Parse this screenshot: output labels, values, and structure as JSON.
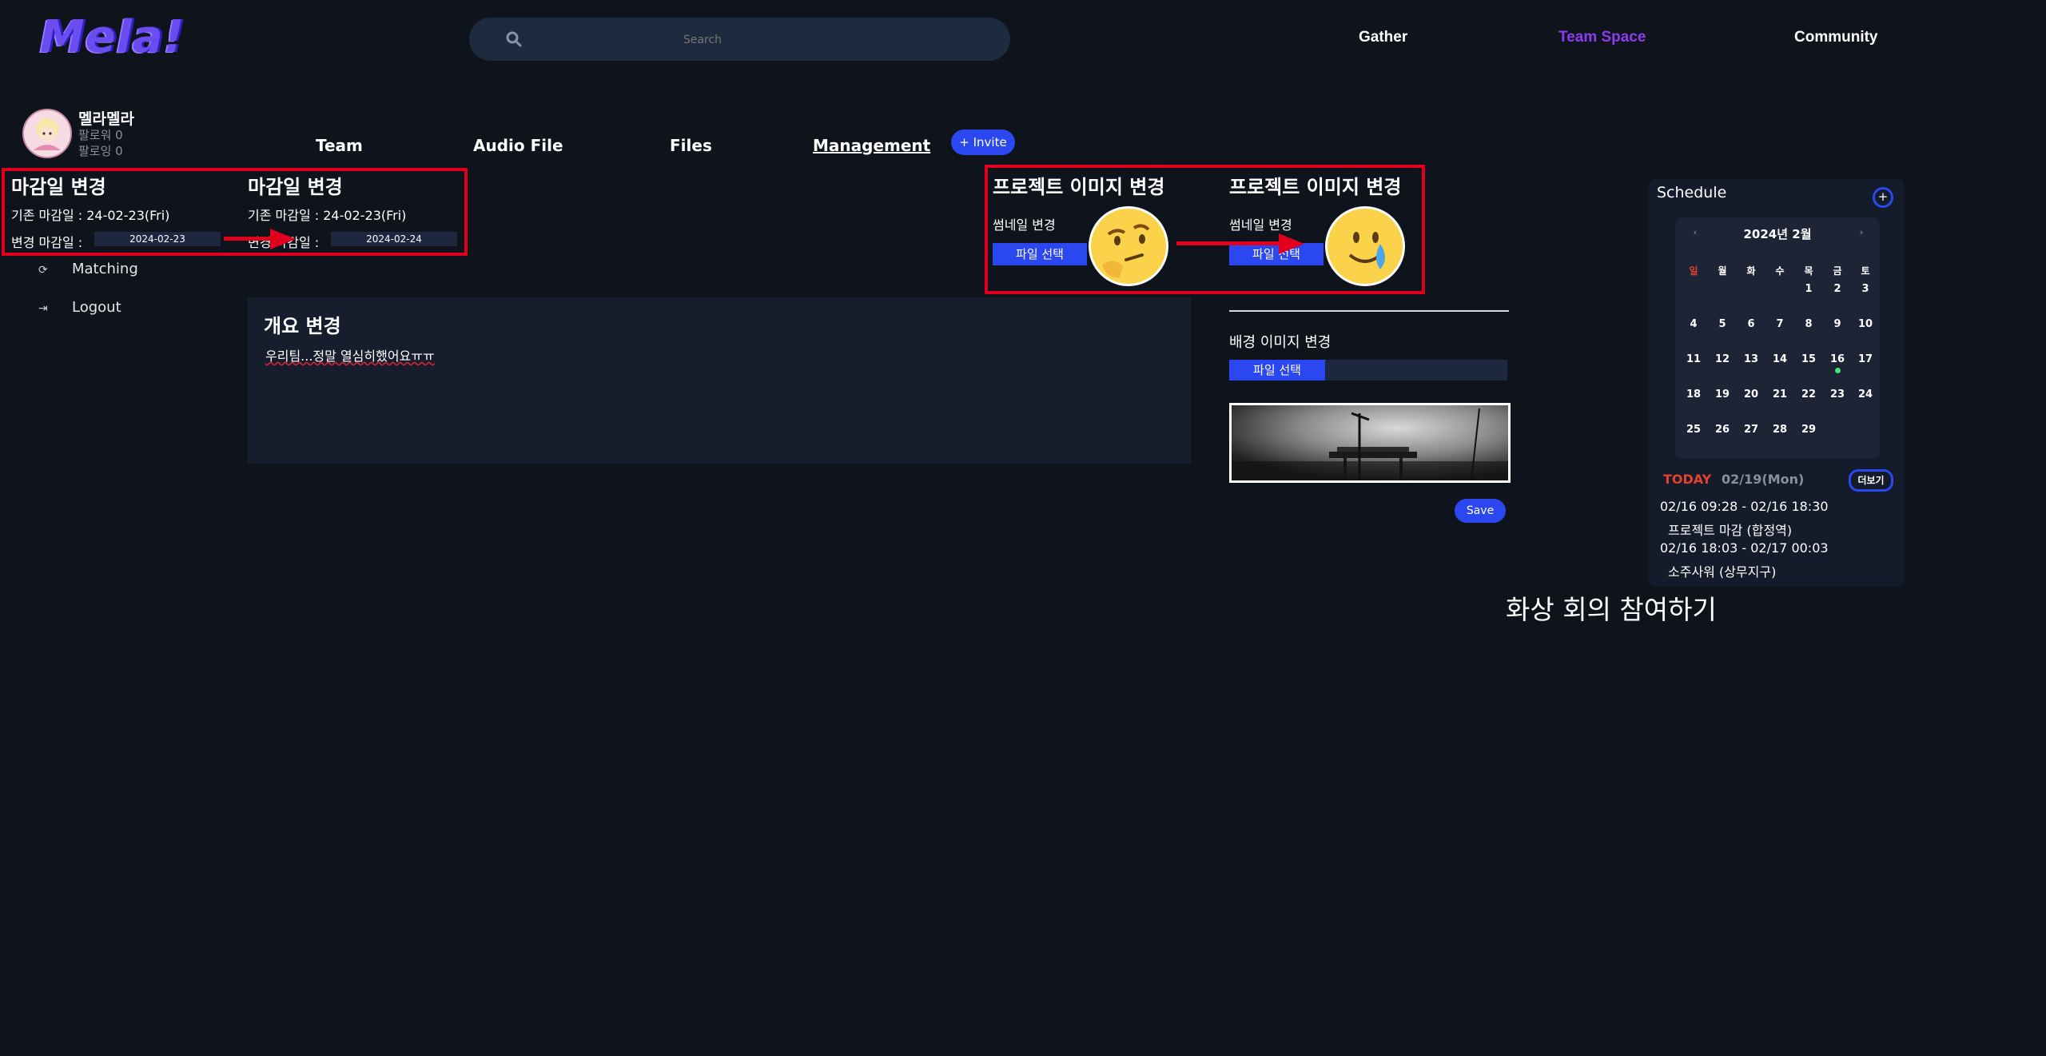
{
  "app": {
    "logo_text": "Mela!"
  },
  "search": {
    "placeholder": "Search"
  },
  "topnav": [
    {
      "label": "Gather",
      "color": "#ffffff"
    },
    {
      "label": "Team Space",
      "color": "#8e3cf0"
    },
    {
      "label": "Community",
      "color": "#ffffff"
    }
  ],
  "profile": {
    "name": "멜라멜라",
    "followers": "팔로워 0",
    "following": "팔로잉 0"
  },
  "sidebar": [
    {
      "label": "Matching",
      "icon": "matching-icon"
    },
    {
      "label": "Logout",
      "icon": "logout-icon"
    }
  ],
  "tabs": [
    "Team",
    "Audio File",
    "Files",
    "Management"
  ],
  "invite_label": "+ Invite",
  "deadline": {
    "left": {
      "title": "마감일 변경",
      "current": "기존 마감일 : 24-02-23(Fri)",
      "change_label": "변경 마감일 :",
      "date": "2024-02-23"
    },
    "right": {
      "title": "마감일 변경",
      "current": "기존 마감일 : 24-02-23(Fri)",
      "change_label": "변경 마감일 :",
      "date": "2024-02-24"
    }
  },
  "overview": {
    "title": "개요 변경",
    "text": "우리팀...정말 열심히했어요ㅠㅠ"
  },
  "project_image": {
    "left": {
      "title": "프로젝트 이미지 변경",
      "thumb_label": "썸네일 변경",
      "button": "파일 선택",
      "emoji": "thinking-face"
    },
    "right": {
      "title": "프로젝트 이미지 변경",
      "thumb_label": "썸네일 변경",
      "button": "파일 선택",
      "emoji": "smiling-face-with-tear"
    }
  },
  "background": {
    "title": "배경 이미지 변경",
    "button": "파일 선택"
  },
  "save_label": "Save",
  "schedule": {
    "title": "Schedule",
    "add_label": "+",
    "month_label": "2024년 2월",
    "weekdays": [
      "일",
      "월",
      "화",
      "수",
      "목",
      "금",
      "토"
    ],
    "weeks": [
      [
        "",
        "",
        "",
        "",
        "1",
        "2",
        "3"
      ],
      [
        "4",
        "5",
        "6",
        "7",
        "8",
        "9",
        "10"
      ],
      [
        "11",
        "12",
        "13",
        "14",
        "15",
        "16",
        "17"
      ],
      [
        "18",
        "19",
        "20",
        "21",
        "22",
        "23",
        "24"
      ],
      [
        "25",
        "26",
        "27",
        "28",
        "29",
        "",
        ""
      ]
    ],
    "event_dot_day": "16",
    "today_label": "TODAY",
    "today_date": "02/19(Mon)",
    "more_label": "더보기",
    "events": [
      {
        "time": "02/16 09:28 - 02/16 18:30",
        "title": "프로젝트 마감 (합정역)"
      },
      {
        "time": "02/16 18:03 - 02/17 00:03",
        "title": "소주사워 (상무지구)"
      }
    ]
  },
  "video_call_label": "화상 회의 참여하기",
  "colors": {
    "bg": "#0f131c",
    "accent": "#2b48f0",
    "highlight": "#e0001e",
    "team_space": "#8e3cf0",
    "today": "#e8412c"
  }
}
